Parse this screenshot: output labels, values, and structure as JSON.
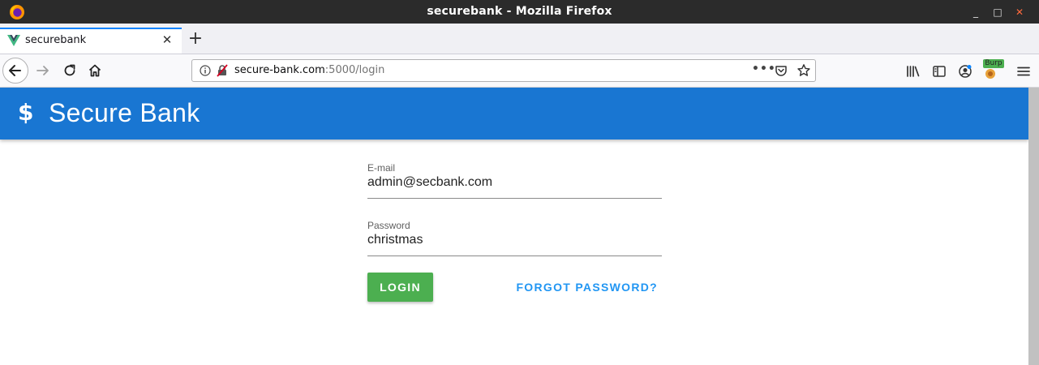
{
  "window": {
    "title": "securebank - Mozilla Firefox",
    "minimize": "_",
    "maximize": "□",
    "close": "✕"
  },
  "tabs": [
    {
      "label": "securebank",
      "close": "✕",
      "active": true
    }
  ],
  "new_tab": "+",
  "navbar": {
    "url_host": "secure-bank.com",
    "url_path": ":5000/login",
    "page_actions": "•••",
    "burp_badge": "Burp"
  },
  "app": {
    "brand_icon": "$",
    "title": "Secure Bank",
    "header_color": "#1976d2"
  },
  "login_form": {
    "email_label": "E-mail",
    "email_value": "admin@secbank.com",
    "password_label": "Password",
    "password_value": "christmas",
    "login_label": "LOGIN",
    "login_color": "#4caf50",
    "forgot_label": "FORGOT PASSWORD?",
    "forgot_color": "#2196f3"
  }
}
